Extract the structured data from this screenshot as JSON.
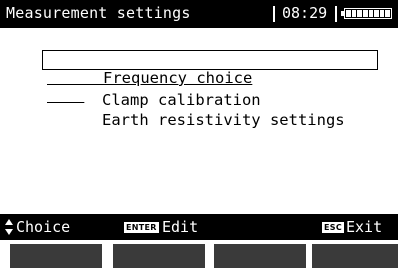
{
  "header": {
    "title": "Measurement settings",
    "time": "08:29",
    "battery_icon": "battery-full-icon"
  },
  "menu": {
    "items": [
      {
        "label": "Frequency choice",
        "selected": true
      },
      {
        "label": "Clamp calibration",
        "selected": false
      },
      {
        "label": "Earth resistivity settings",
        "selected": false
      }
    ]
  },
  "footer": {
    "choice_icon": "up-down-arrows-icon",
    "choice_label": "Choice",
    "enter_key": "ENTER",
    "edit_label": "Edit",
    "esc_key": "ESC",
    "exit_label": "Exit"
  },
  "softkeys": [
    "",
    "",
    "",
    ""
  ],
  "colors": {
    "bar_background": "#000000",
    "softkey_fill": "#3a3a3a",
    "screen_background": "#ffffff"
  }
}
